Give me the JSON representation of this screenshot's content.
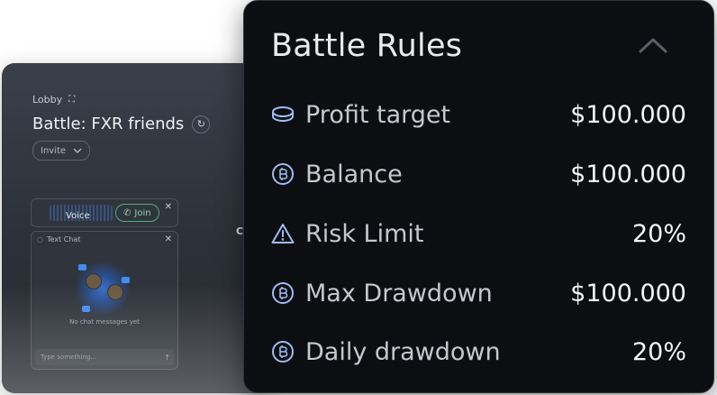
{
  "background": {
    "lobby_label": "Lobby",
    "battle_title": "Battle: FXR friends",
    "invite_label": "Invite",
    "voice_label": "Voice",
    "join_label": "Join",
    "chat_title": "Text Chat",
    "chat_empty": "No chat messages yet",
    "chat_placeholder": "Type something...",
    "edge_letter": "C"
  },
  "panel": {
    "title": "Battle Rules",
    "rules": [
      {
        "icon": "coin-stack-icon",
        "label": "Profit target",
        "value": "$100.000"
      },
      {
        "icon": "coin-icon",
        "label": "Balance",
        "value": "$100.000"
      },
      {
        "icon": "warning-icon",
        "label": "Risk Limit",
        "value": "20%"
      },
      {
        "icon": "coin-icon",
        "label": "Max Drawdown",
        "value": "$100.000"
      },
      {
        "icon": "coin-icon",
        "label": "Daily drawdown",
        "value": "20%"
      }
    ]
  },
  "colors": {
    "icon_blue": "#9dbdf3",
    "panel_bg": "#0d0e11",
    "join_green": "#4fae7a"
  }
}
